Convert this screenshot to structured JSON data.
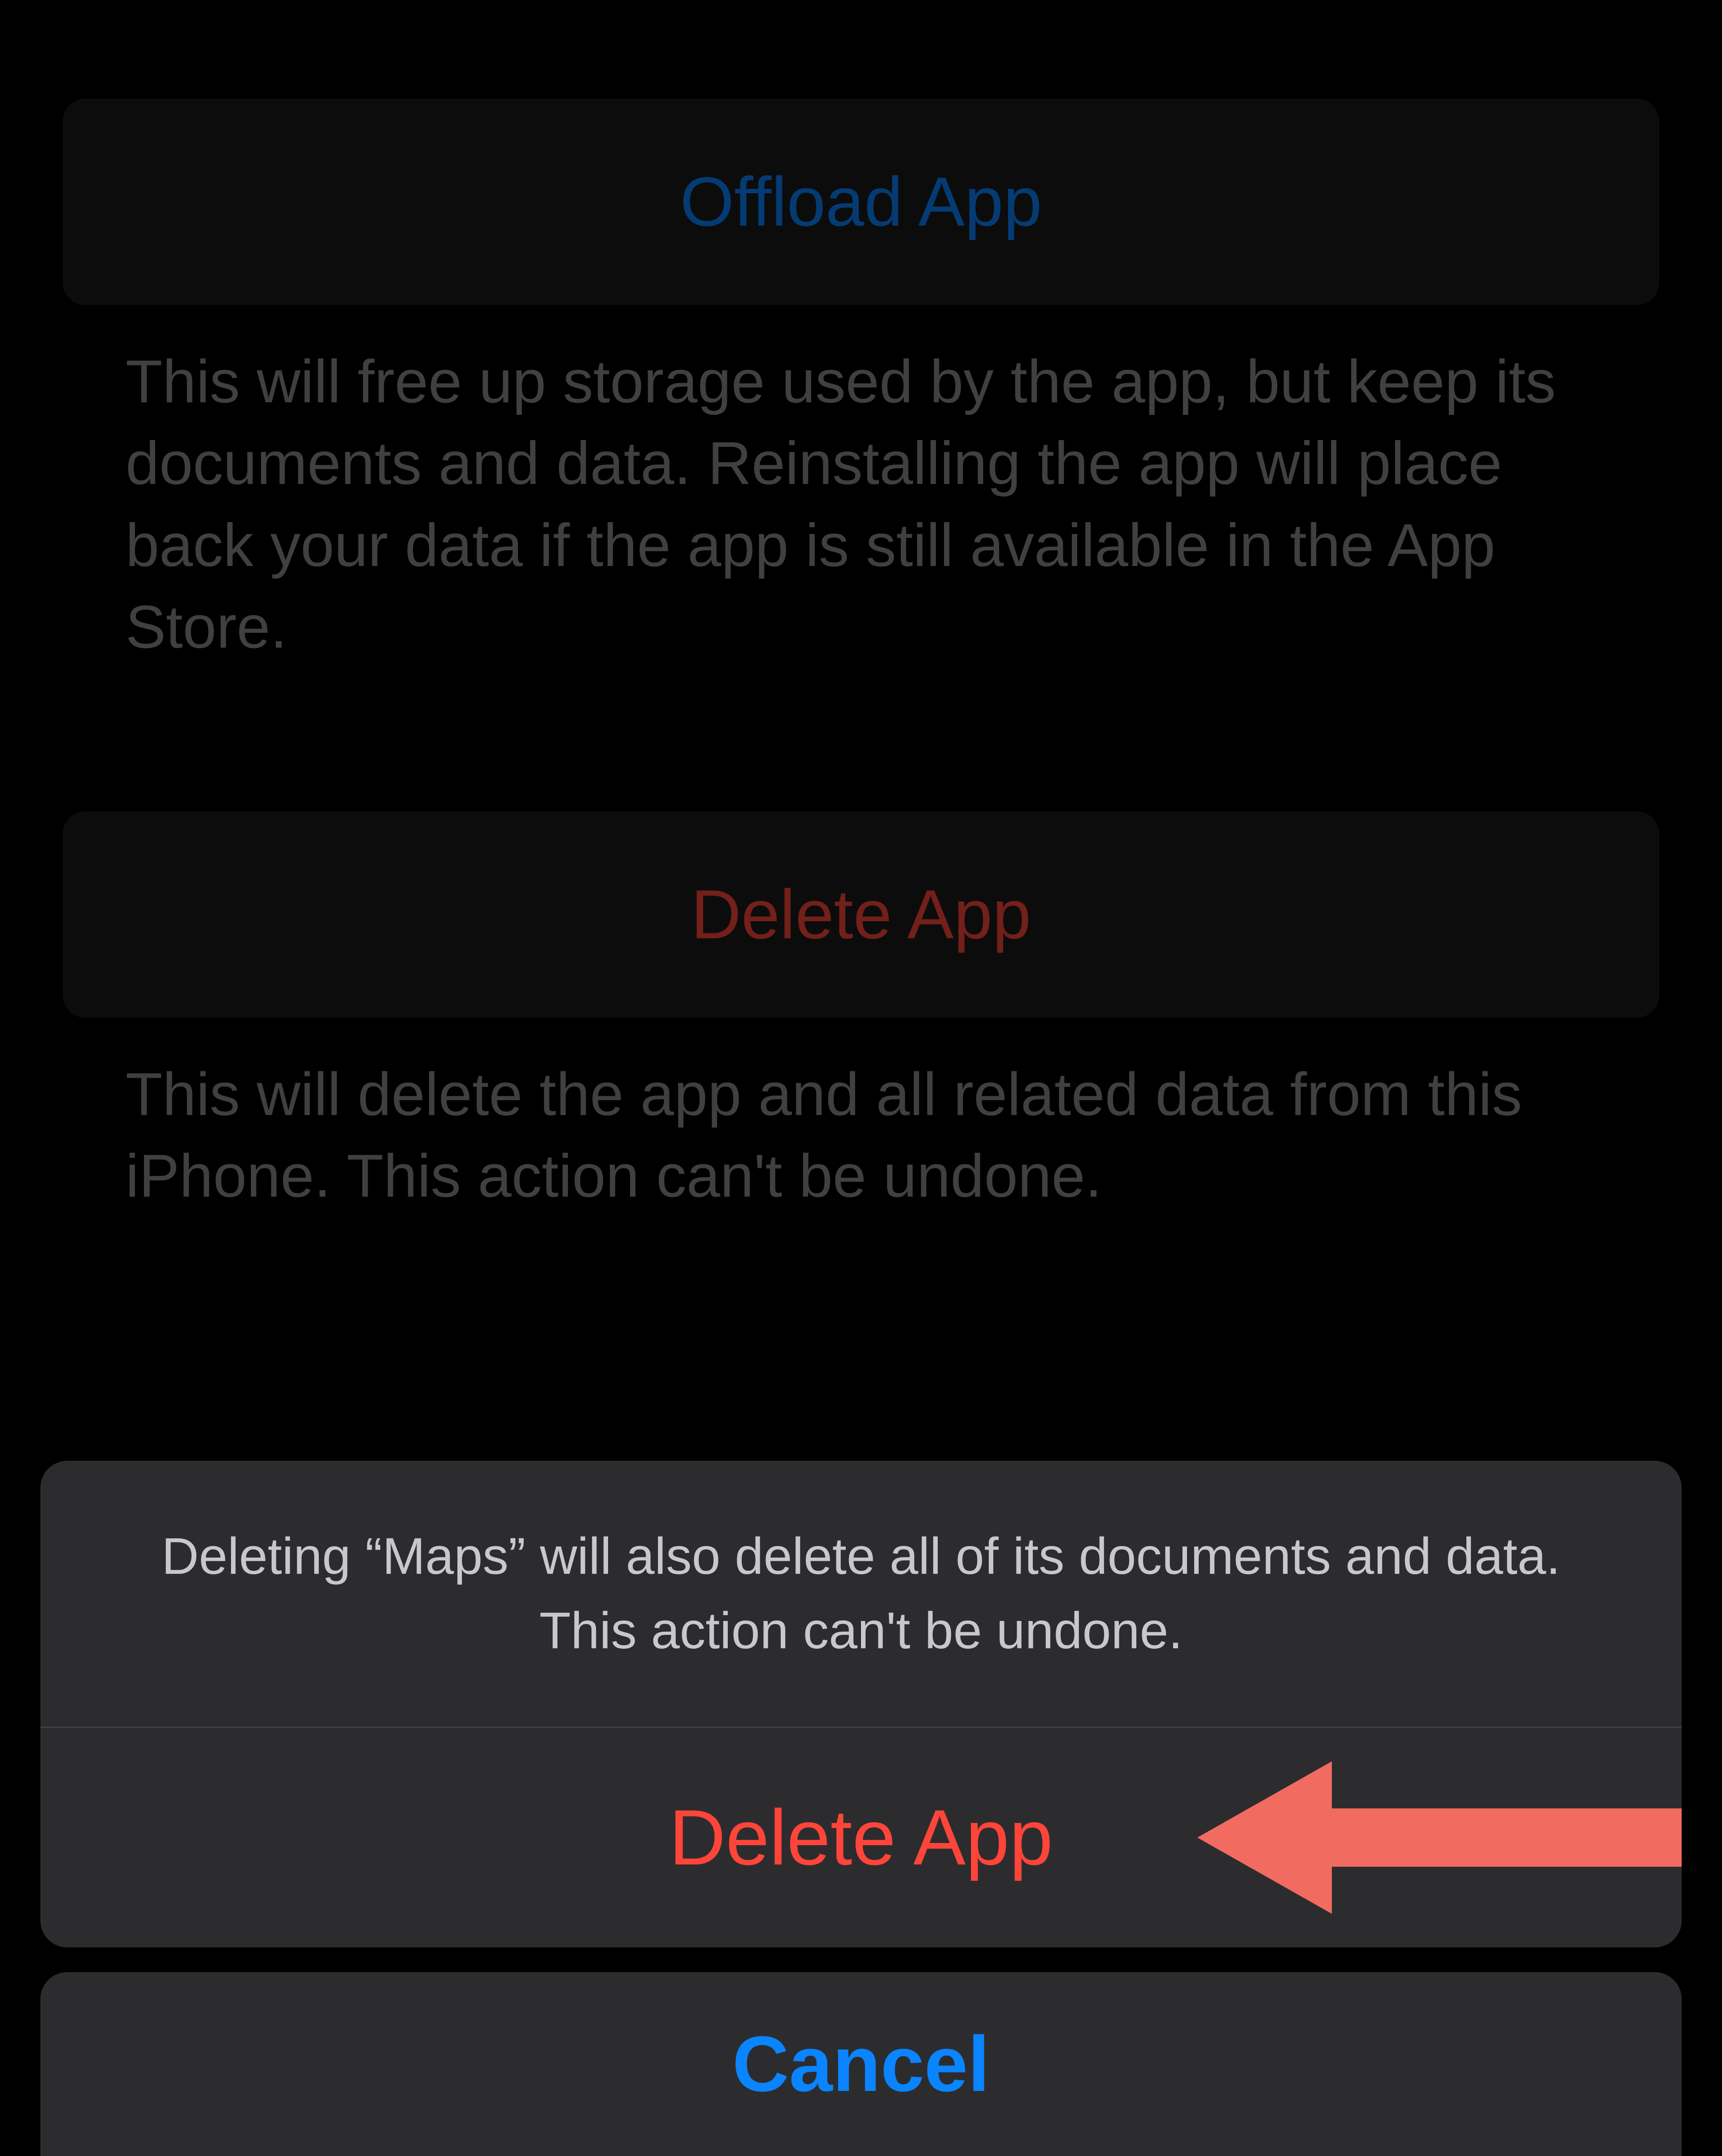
{
  "sections": {
    "offload": {
      "button_label": "Offload App",
      "description": "This will free up storage used by the app, but keep its documents and data. Reinstalling the app will place back your data if the app is still available in the App Store."
    },
    "delete": {
      "button_label": "Delete App",
      "description": "This will delete the app and all related data from this iPhone. This action can't be undone."
    }
  },
  "action_sheet": {
    "message": "Deleting “Maps” will also delete all of its documents and data. This action can't be undone.",
    "delete_label": "Delete App",
    "cancel_label": "Cancel"
  },
  "colors": {
    "system_blue": "#0a84ff",
    "system_red": "#ff453a",
    "annotation_red": "#f26b60"
  }
}
